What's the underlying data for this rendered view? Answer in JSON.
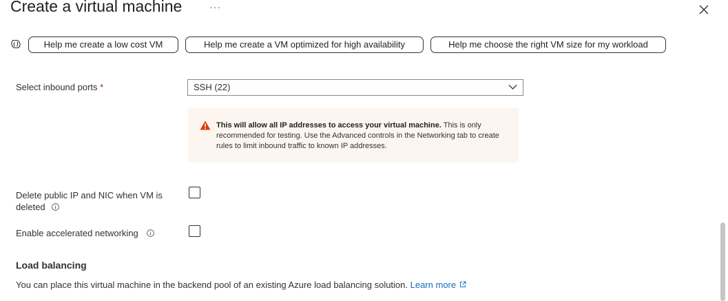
{
  "header": {
    "title": "Create a virtual machine",
    "more_label": "···",
    "close_icon": "close-icon"
  },
  "assist": {
    "icon": "copilot-icon",
    "buttons": [
      "Help me create a low cost VM",
      "Help me create a VM optimized for high availability",
      "Help me choose the right VM size for my workload"
    ]
  },
  "inbound_ports": {
    "label": "Select inbound ports",
    "required_mark": "*",
    "selected": "SSH (22)"
  },
  "warning": {
    "icon": "warning-icon",
    "bold": "This will allow all IP addresses to access your virtual machine.",
    "body": "This is only recommended for testing.  Use the Advanced controls in the Networking tab to create rules to limit inbound traffic to known IP addresses."
  },
  "delete_public_ip": {
    "label_line1": "Delete public IP and NIC when VM is",
    "label_line2": "deleted",
    "checked": false
  },
  "accelerated_networking": {
    "label": "Enable accelerated networking",
    "checked": false
  },
  "load_balancing": {
    "heading": "Load balancing",
    "description": "You can place this virtual machine in the backend pool of an existing Azure load balancing solution.",
    "link": "Learn more"
  },
  "colors": {
    "link": "#0f6cbd",
    "warning_bg": "#fdf6f0",
    "warning_icon": "#d83b01",
    "required": "#a4262c"
  }
}
